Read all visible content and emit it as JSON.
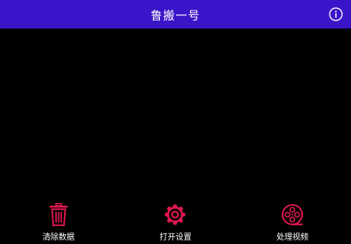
{
  "header": {
    "title": "鲁搬一号",
    "info_icon": "info-circle-icon",
    "background_color": "#3a14c8"
  },
  "actions": [
    {
      "label": "清除数据",
      "icon": "trash-icon"
    },
    {
      "label": "打开设置",
      "icon": "gear-icon"
    },
    {
      "label": "处理视频",
      "icon": "film-reel-icon"
    }
  ],
  "accent_color": "#e0184f"
}
